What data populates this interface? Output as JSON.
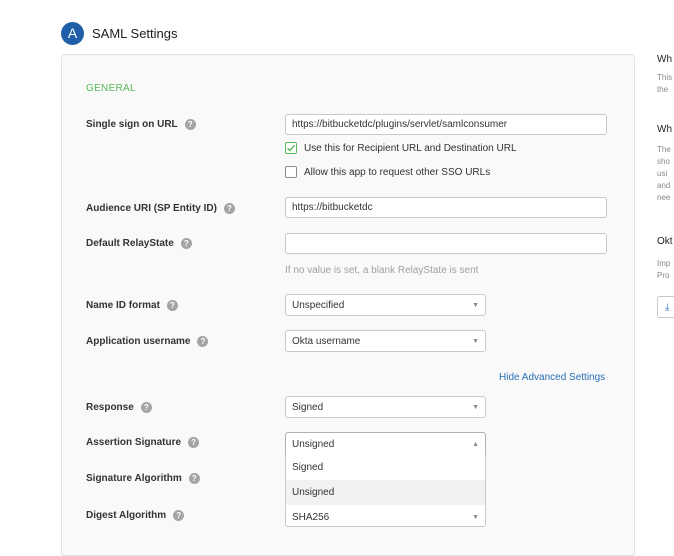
{
  "header": {
    "step_letter": "A",
    "title": "SAML Settings"
  },
  "section_title": "GENERAL",
  "fields": {
    "sso_url": {
      "label": "Single sign on URL",
      "value": "https://bitbucketdc/plugins/servlet/samlconsumer"
    },
    "recipient_checkbox": {
      "label": "Use this for Recipient URL and Destination URL",
      "checked": true
    },
    "other_sso_checkbox": {
      "label": "Allow this app to request other SSO URLs",
      "checked": false
    },
    "audience_uri": {
      "label": "Audience URI (SP Entity ID)",
      "value": "https://bitbucketdc"
    },
    "relay_state": {
      "label": "Default RelayState",
      "value": "",
      "hint": "If no value is set, a blank RelayState is sent"
    },
    "name_id_format": {
      "label": "Name ID format",
      "selected": "Unspecified"
    },
    "app_username": {
      "label": "Application username",
      "selected": "Okta username"
    }
  },
  "advanced_link": "Hide Advanced Settings",
  "advanced": {
    "response": {
      "label": "Response",
      "selected": "Signed"
    },
    "assertion_signature": {
      "label": "Assertion Signature",
      "selected": "Unsigned",
      "options": [
        "Signed",
        "Unsigned"
      ]
    },
    "signature_algorithm": {
      "label": "Signature Algorithm"
    },
    "digest_algorithm": {
      "label": "Digest Algorithm",
      "selected": "SHA256"
    }
  },
  "right_column": {
    "heading1": "Wh",
    "text1_line1": "This",
    "text1_line2": "the",
    "heading2": "Wh",
    "text2_lines": [
      "The",
      "sho",
      "usi",
      "and",
      "nee"
    ],
    "heading3": "Okt",
    "text3_line1": "Imp",
    "text3_line2": "Pro"
  },
  "colors": {
    "accent": "#1e5fa8",
    "section": "#5cb85c",
    "link": "#2870b7"
  }
}
